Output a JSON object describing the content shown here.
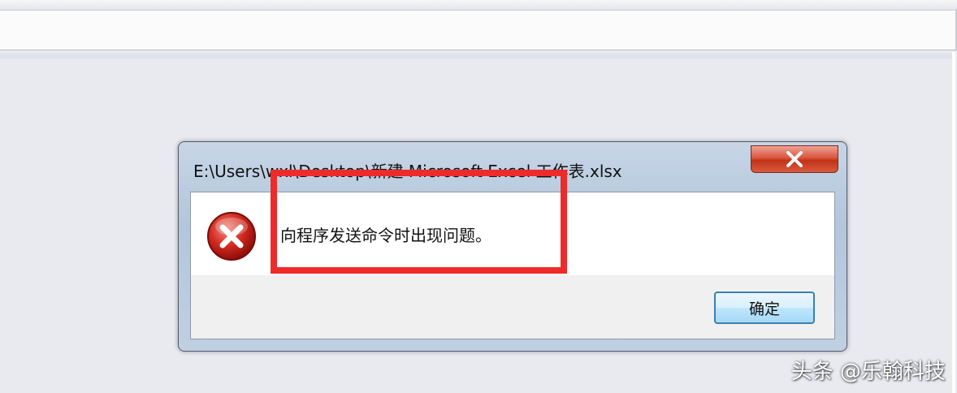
{
  "dialog": {
    "title": "E:\\Users\\wxl\\Desktop\\新建 Microsoft Excel 工作表.xlsx",
    "message": "向程序发送命令时出现问题。",
    "ok_label": "确定",
    "close_symbol": "X",
    "icon": "error-icon"
  },
  "annotation": {
    "highlight_color": "#ee2b2b"
  },
  "watermark": {
    "text": "头条 @乐翰科技"
  }
}
